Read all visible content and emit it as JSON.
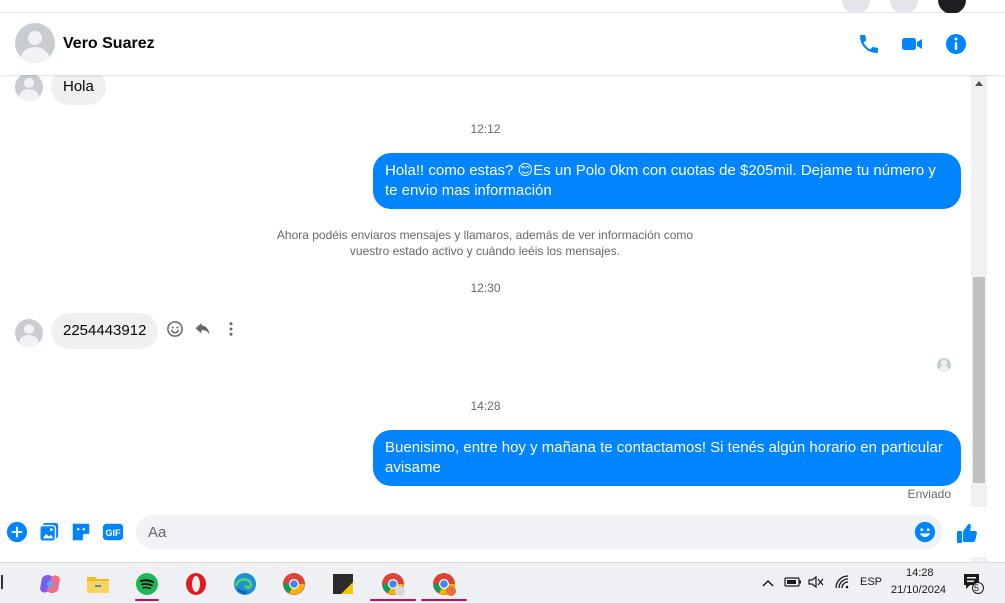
{
  "header": {
    "contact_name": "Vero Suarez",
    "actions": [
      "phone-icon",
      "video-icon",
      "info-icon"
    ]
  },
  "messages": {
    "prev_incoming": "Hola",
    "ts1": "12:12",
    "out1": "Hola!! como estas? 😊Es un Polo 0km con cuotas de $205mil. Dejame tu número y te envio mas información",
    "system_line1": "Ahora podéis enviaros mensajes y llamaros, además de ver información como",
    "system_line2": "vuestro estado activo y cuándo leéis los mensajes.",
    "ts2": "12:30",
    "in_phone": "2254443912",
    "ts3": "14:28",
    "out2": "Buenisimo, entre hoy y mañana te contactamos! Si tenés algún horario en particular avisame",
    "status": "Enviado"
  },
  "composer": {
    "placeholder": "Aa"
  },
  "taskbar": {
    "lang": "ESP",
    "time": "14:28",
    "date": "21/10/2024",
    "notif_count": "5"
  },
  "colors": {
    "accent": "#0084ff",
    "incoming_bubble": "#f0f0f0",
    "meta_text": "#65676b"
  }
}
